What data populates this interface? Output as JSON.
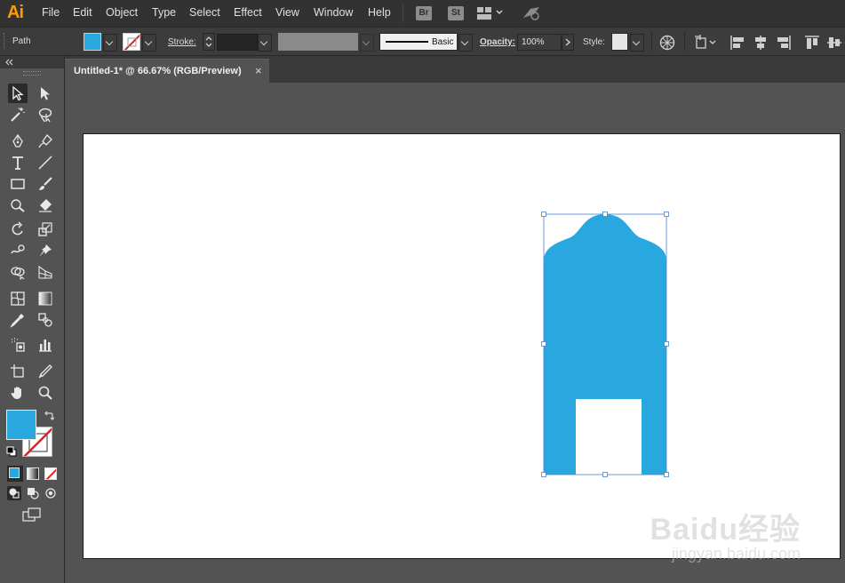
{
  "app": {
    "logo": "Ai"
  },
  "menu": [
    "File",
    "Edit",
    "Object",
    "Type",
    "Select",
    "Effect",
    "View",
    "Window",
    "Help"
  ],
  "menubar_badges": [
    "Br",
    "St"
  ],
  "control_bar": {
    "object_label": "Path",
    "stroke_label": "Stroke:",
    "brush_label": "Basic",
    "opacity_label": "Opacity:",
    "opacity_value": "100%",
    "style_label": "Style:"
  },
  "document": {
    "tab_title": "Untitled-1* @ 66.67% (RGB/Preview)",
    "close_glyph": "×"
  },
  "colors": {
    "fill": "#29a8e0",
    "selection": "#4a7fd4",
    "accent": "#ff9a00"
  },
  "watermark": {
    "brand": "Baidu经验",
    "url": "jingyan.baidu.com"
  }
}
